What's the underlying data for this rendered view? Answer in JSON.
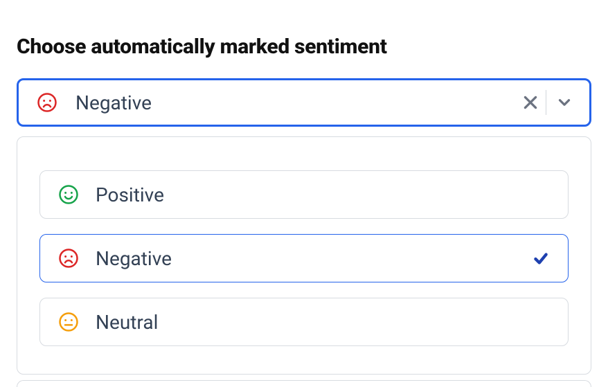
{
  "title": "Choose automatically marked sentiment",
  "select": {
    "value_label": "Negative",
    "value_icon": "frown-icon",
    "value_icon_color": "red"
  },
  "options": [
    {
      "label": "Positive",
      "icon": "smile-icon",
      "color": "green",
      "selected": false
    },
    {
      "label": "Negative",
      "icon": "frown-icon",
      "color": "red",
      "selected": true
    },
    {
      "label": "Neutral",
      "icon": "meh-icon",
      "color": "orange",
      "selected": false
    }
  ]
}
